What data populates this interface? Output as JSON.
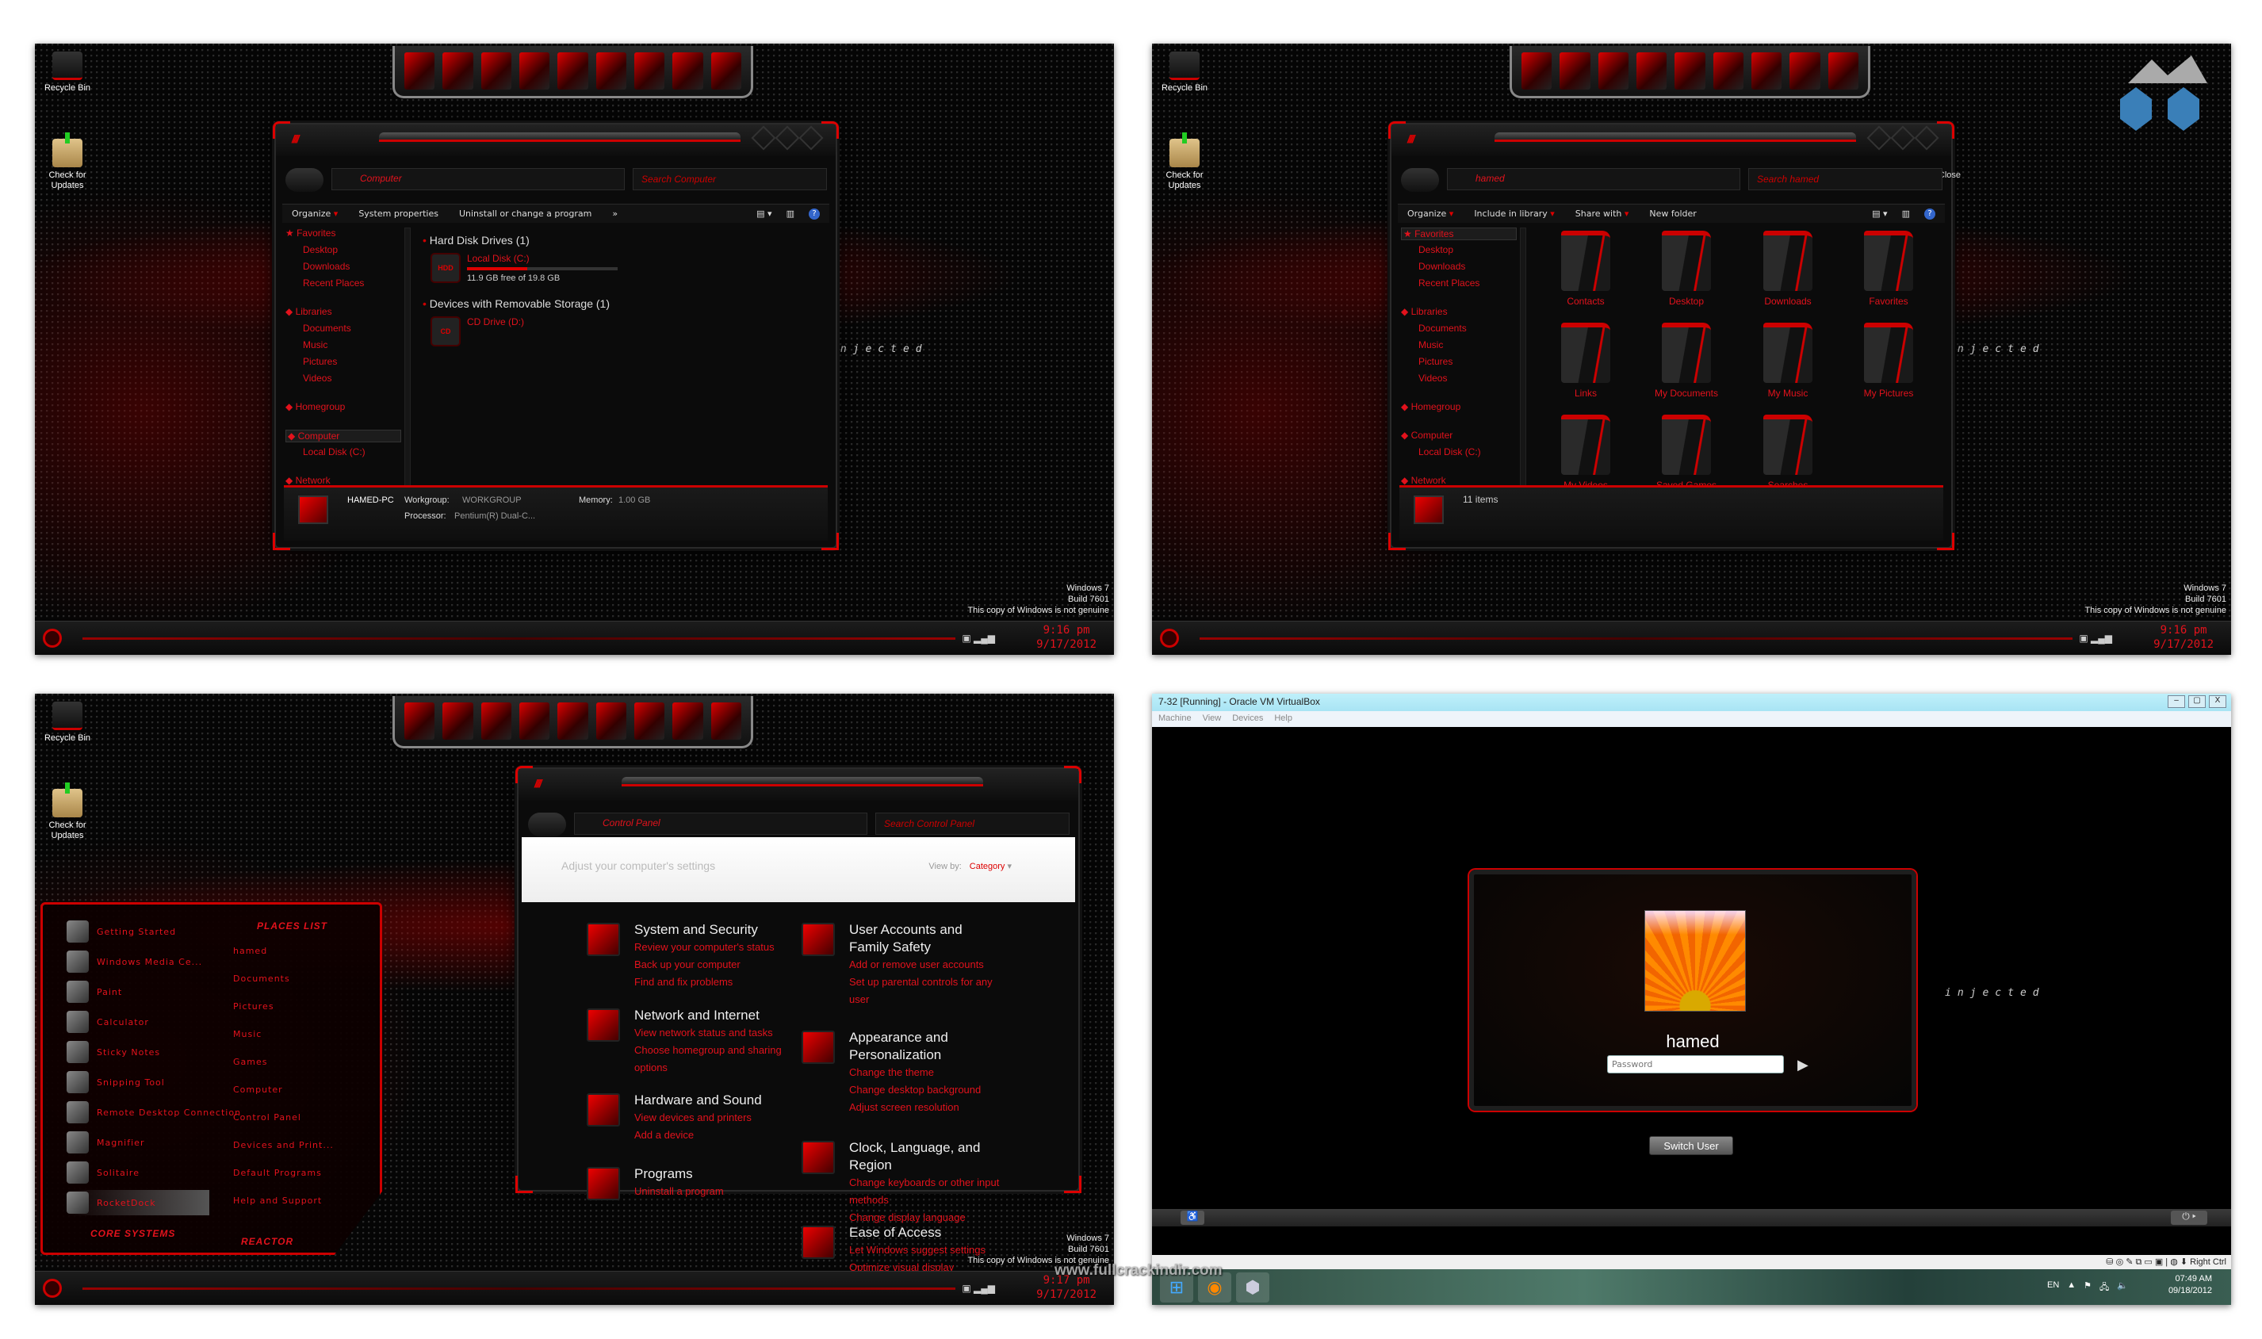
{
  "desktop": {
    "recycle_bin": "Recycle Bin",
    "check_updates": "Check for Updates",
    "injected": "injected",
    "watermark": {
      "line1": "Windows 7",
      "line2": "Build 7601",
      "line3": "This copy of Windows is not genuine"
    }
  },
  "taskbar_clocks": [
    {
      "time": "9:16 pm",
      "date": "9/17/2012"
    },
    {
      "time": "9:16 pm",
      "date": "9/17/2012"
    },
    {
      "time": "9:17 pm",
      "date": "9/17/2012"
    }
  ],
  "explorer_computer": {
    "address": "Computer",
    "search_placeholder": "Search Computer",
    "toolbar": [
      "Organize",
      "System properties",
      "Uninstall or change a program",
      "»"
    ],
    "nav": [
      {
        "label": "Favorites",
        "level": 0
      },
      {
        "label": "Desktop",
        "level": 1
      },
      {
        "label": "Downloads",
        "level": 1
      },
      {
        "label": "Recent Places",
        "level": 1
      },
      {
        "label": "Libraries",
        "level": 0
      },
      {
        "label": "Documents",
        "level": 1
      },
      {
        "label": "Music",
        "level": 1
      },
      {
        "label": "Pictures",
        "level": 1
      },
      {
        "label": "Videos",
        "level": 1
      },
      {
        "label": "Homegroup",
        "level": 0
      },
      {
        "label": "Computer",
        "level": 0,
        "selected": true
      },
      {
        "label": "Local Disk (C:)",
        "level": 1
      },
      {
        "label": "Network",
        "level": 0
      }
    ],
    "groups": [
      {
        "title": "Hard Disk Drives (1)",
        "drive": {
          "icon": "HDD",
          "name": "Local Disk (C:)",
          "free": "11.9 GB free of 19.8 GB",
          "used_fraction": 0.4
        }
      },
      {
        "title": "Devices with Removable Storage (1)",
        "drive": {
          "icon": "CD",
          "name": "CD Drive (D:)"
        }
      }
    ],
    "details": {
      "pc_name": "HAMED-PC",
      "workgroup_label": "Workgroup:",
      "workgroup": "WORKGROUP",
      "memory_label": "Memory:",
      "memory": "1.00 GB",
      "processor_label": "Processor:",
      "processor": "Pentium(R) Dual-C..."
    }
  },
  "explorer_user": {
    "address": "hamed",
    "search_placeholder": "Search hamed",
    "close_tooltip": "Close",
    "toolbar": [
      "Organize",
      "Include in library",
      "Share with",
      "New folder"
    ],
    "nav": [
      {
        "label": "Favorites",
        "level": 0,
        "selected": true
      },
      {
        "label": "Desktop",
        "level": 1
      },
      {
        "label": "Downloads",
        "level": 1
      },
      {
        "label": "Recent Places",
        "level": 1
      },
      {
        "label": "Libraries",
        "level": 0
      },
      {
        "label": "Documents",
        "level": 1
      },
      {
        "label": "Music",
        "level": 1
      },
      {
        "label": "Pictures",
        "level": 1
      },
      {
        "label": "Videos",
        "level": 1
      },
      {
        "label": "Homegroup",
        "level": 0
      },
      {
        "label": "Computer",
        "level": 0
      },
      {
        "label": "Local Disk (C:)",
        "level": 1
      },
      {
        "label": "Network",
        "level": 0
      }
    ],
    "folders": [
      "Contacts",
      "Desktop",
      "Downloads",
      "Favorites",
      "Links",
      "My Documents",
      "My Music",
      "My Pictures",
      "My Videos",
      "Saved Games",
      "Searches"
    ],
    "status": "11 items"
  },
  "control_panel": {
    "address": "Control Panel",
    "search_placeholder": "Search Control Panel",
    "heading": "Adjust your computer's settings",
    "view_by_label": "View by:",
    "view_by_value": "Category",
    "categories": [
      {
        "title": "System and Security",
        "links": [
          "Review your computer's status",
          "Back up your computer",
          "Find and fix problems"
        ]
      },
      {
        "title": "Network and Internet",
        "links": [
          "View network status and tasks",
          "Choose homegroup and sharing options"
        ]
      },
      {
        "title": "Hardware and Sound",
        "links": [
          "View devices and printers",
          "Add a device"
        ]
      },
      {
        "title": "Programs",
        "links": [
          "Uninstall a program"
        ]
      },
      {
        "title": "User Accounts and Family Safety",
        "links": [
          "Add or remove user accounts",
          "Set up parental controls for any user"
        ]
      },
      {
        "title": "Appearance and Personalization",
        "links": [
          "Change the theme",
          "Change desktop background",
          "Adjust screen resolution"
        ]
      },
      {
        "title": "Clock, Language, and Region",
        "links": [
          "Change keyboards or other input methods",
          "Change display language"
        ]
      },
      {
        "title": "Ease of Access",
        "links": [
          "Let Windows suggest settings",
          "Optimize visual display"
        ]
      }
    ]
  },
  "start_menu": {
    "programs": [
      "Getting Started",
      "Windows Media Ce...",
      "Paint",
      "Calculator",
      "Sticky Notes",
      "Snipping Tool",
      "Remote Desktop Connection",
      "Magnifier",
      "Solitaire",
      "RocketDock"
    ],
    "places_title": "PLACES LIST",
    "places": [
      "hamed",
      "Documents",
      "Pictures",
      "Music",
      "Games",
      "Computer",
      "Control Panel",
      "Devices and Print...",
      "Default Programs",
      "Help and Support"
    ],
    "core_systems": "CORE SYSTEMS",
    "reactor": "REACTOR"
  },
  "virtualbox": {
    "title": "7-32 [Running] - Oracle VM VirtualBox",
    "menu": [
      "Machine",
      "View",
      "Devices",
      "Help"
    ],
    "login": {
      "username": "hamed",
      "password_placeholder": "Password",
      "switch_user": "Switch User"
    },
    "host_key": "Right Ctrl",
    "host_taskbar": {
      "language": "EN",
      "time": "07:49 AM",
      "date": "09/18/2012"
    }
  },
  "site_watermark": "www.fullcrackindir.com"
}
